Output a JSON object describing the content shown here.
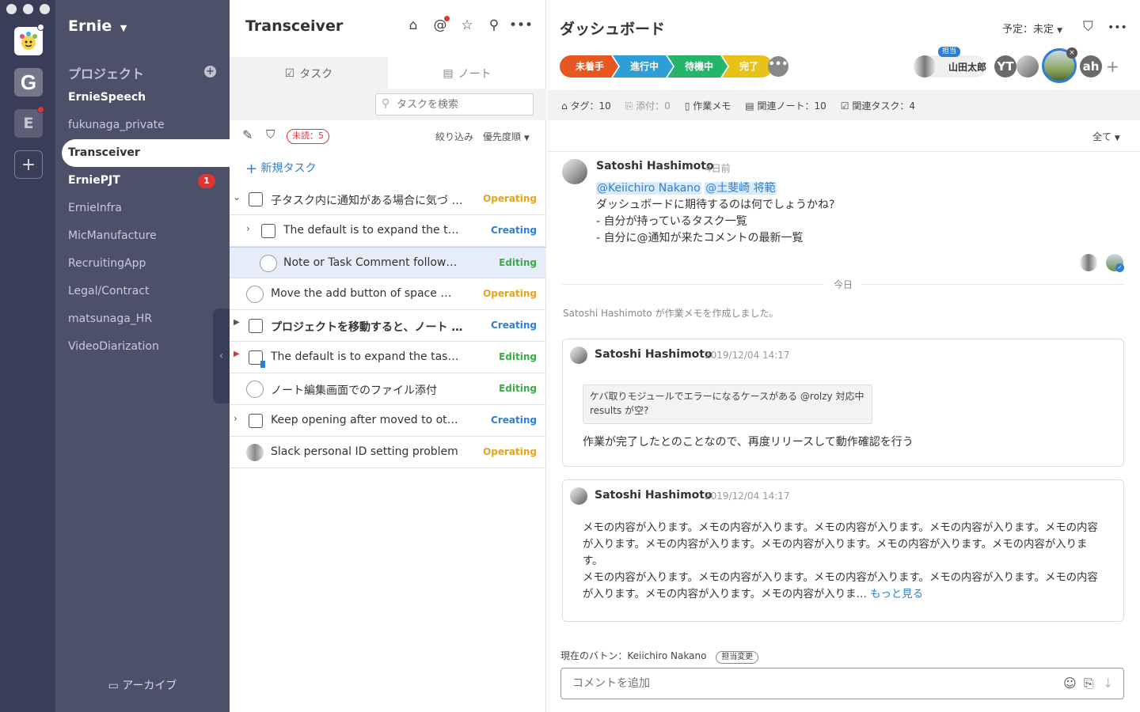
{
  "workspace": {
    "name": "Ernie",
    "rail_label": "E"
  },
  "sidebar": {
    "section_title": "プロジェクト",
    "projects": [
      {
        "label": "ErnieSpeech",
        "bold": true
      },
      {
        "label": "fukunaga_private"
      },
      {
        "label": "Transceiver",
        "active": true
      },
      {
        "label": "ErniePJT",
        "bold": true,
        "badge": "1"
      },
      {
        "label": "ErnieInfra"
      },
      {
        "label": "MicManufacture"
      },
      {
        "label": "RecruitingApp"
      },
      {
        "label": "Legal/Contract"
      },
      {
        "label": "matsunaga_HR"
      },
      {
        "label": "VideoDiarization"
      }
    ],
    "archive_label": "アーカイブ"
  },
  "middle": {
    "title": "Transceiver",
    "tab_task": "タスク",
    "tab_note": "ノート",
    "search_placeholder": "タスクを検索",
    "unread_label": "未読：5",
    "filter_label": "絞り込み",
    "sort_label": "優先度順",
    "new_task_label": "新規タスク",
    "tasks": [
      {
        "title": "子タスク内に通知がある場合に気づ …",
        "status": "Operating"
      },
      {
        "title": "The default is to expand the task",
        "status": "Creating"
      },
      {
        "title": "Note or Task Comment follow …",
        "status": "Editing"
      },
      {
        "title": "Move the add button of space …",
        "status": "Operating"
      },
      {
        "title": "プロジェクトを移動すると、ノート …",
        "status": "Creating"
      },
      {
        "title": "The default is to expand the task tree",
        "status": "Editing"
      },
      {
        "title": "ノート編集画面でのファイル添付",
        "status": "Editing"
      },
      {
        "title": "Keep opening after moved to other …",
        "status": "Creating"
      },
      {
        "title": "Slack personal ID setting problem",
        "status": "Operating"
      }
    ]
  },
  "right": {
    "title": "ダッシュボード",
    "schedule_label": "予定：未定",
    "stages": [
      "未着手",
      "進行中",
      "待機中",
      "完了"
    ],
    "stage_more": "•••",
    "assignee_tag": "担当",
    "assignee_name": "山田太郎",
    "members": [
      "YT",
      "ah"
    ],
    "info": {
      "tags": "タグ：10",
      "attach": "添付：0",
      "memo": "作業メモ",
      "notes": "関連ノート：10",
      "tasks": "関連タスク：4"
    },
    "filter_all": "全て",
    "comment1": {
      "author": "Satoshi Hashimoto",
      "time": "4日前",
      "mention1": "@Keiichiro Nakano",
      "mention2": "@土斐崎 将範",
      "line1": "ダッシュボードに期待するのは何でしょうかね?",
      "line2": "- 自分が持っているタスク一覧",
      "line3": "- 自分に@通知が来たコメントの最新一覧"
    },
    "today_label": "今日",
    "system_msg": "Satoshi Hashimoto が作業メモを作成しました。",
    "card1": {
      "author": "Satoshi Hashimoto",
      "time": "2019/12/04 14:17",
      "quote": "ケバ取りモジュールでエラーになるケースがある @rolzy 対応中 results が空?",
      "body": "作業が完了したとのことなので、再度リリースして動作確認を行う"
    },
    "card2": {
      "author": "Satoshi Hashimoto",
      "time": "2019/12/04 14:17",
      "body1": "メモの内容が入ります。メモの内容が入ります。メモの内容が入ります。メモの内容が入ります。メモの内容が入ります。メモの内容が入ります。メモの内容が入ります。メモの内容が入ります。メモの内容が入ります。",
      "body2": "メモの内容が入ります。メモの内容が入ります。メモの内容が入ります。メモの内容が入ります。メモの内容が入ります。メモの内容が入ります。メモの内容が入りま…",
      "more": "もっと見る"
    },
    "baton_label": "現在のバトン：Keiichiro Nakano",
    "baton_change": "担当変更",
    "comment_placeholder": "コメントを追加"
  }
}
